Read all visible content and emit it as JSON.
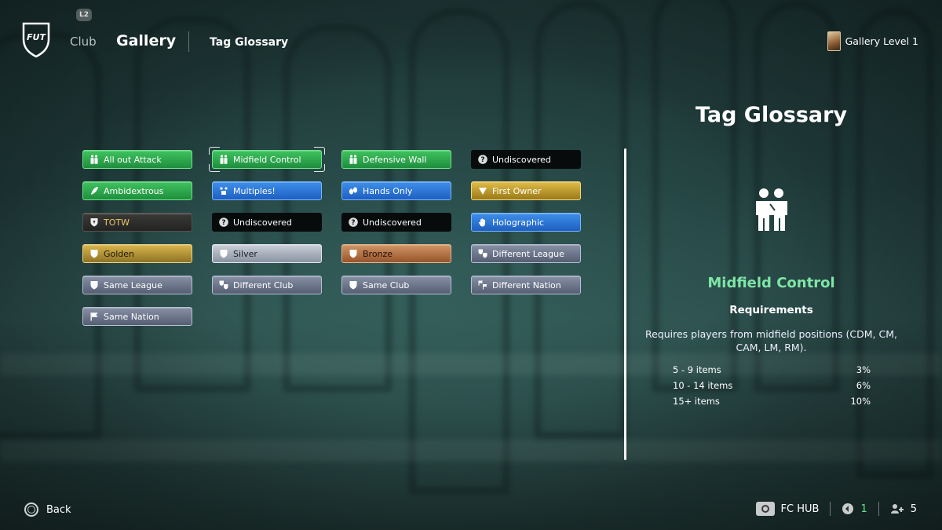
{
  "header": {
    "l2_label": "L2",
    "logo_text": "FUT",
    "nav_club": "Club",
    "nav_gallery": "Gallery",
    "nav_tag_glossary": "Tag Glossary",
    "gallery_level": "Gallery Level 1"
  },
  "tags": [
    {
      "label": "All out Attack",
      "style": "green",
      "icon": "people-icon"
    },
    {
      "label": "Midfield Control",
      "style": "green",
      "icon": "people-icon",
      "selected": true
    },
    {
      "label": "Defensive Wall",
      "style": "green",
      "icon": "people-icon"
    },
    {
      "label": "Undiscovered",
      "style": "black",
      "icon": "question-icon"
    },
    {
      "label": "Ambidextrous",
      "style": "green",
      "icon": "feather-icon"
    },
    {
      "label": "Multiples!",
      "style": "blue",
      "icon": "multiples-icon"
    },
    {
      "label": "Hands Only",
      "style": "blue",
      "icon": "hands-icon"
    },
    {
      "label": "First Owner",
      "style": "gold",
      "icon": "chevron-badge-icon"
    },
    {
      "label": "TOTW",
      "style": "totw",
      "icon": "totw-shield-icon"
    },
    {
      "label": "Undiscovered",
      "style": "black",
      "icon": "question-icon"
    },
    {
      "label": "Undiscovered",
      "style": "black",
      "icon": "question-icon"
    },
    {
      "label": "Holographic",
      "style": "blue",
      "icon": "hand-icon"
    },
    {
      "label": "Golden",
      "style": "gold2",
      "icon": "shield-icon"
    },
    {
      "label": "Silver",
      "style": "silver",
      "icon": "shield-icon"
    },
    {
      "label": "Bronze",
      "style": "bronze",
      "icon": "shield-icon"
    },
    {
      "label": "Different League",
      "style": "steel",
      "icon": "shield-pair-icon"
    },
    {
      "label": "Same League",
      "style": "steel",
      "icon": "shield-icon"
    },
    {
      "label": "Different Club",
      "style": "steel",
      "icon": "shield-pair-icon"
    },
    {
      "label": "Same Club",
      "style": "steel",
      "icon": "shield-icon"
    },
    {
      "label": "Different Nation",
      "style": "steel",
      "icon": "flag-pair-icon"
    },
    {
      "label": "Same Nation",
      "style": "steel",
      "icon": "flag-icon"
    }
  ],
  "panel": {
    "title": "Tag Glossary",
    "selected_name": "Midfield Control",
    "requirements_heading": "Requirements",
    "description": "Requires players from midfield positions (CDM, CM, CAM, LM, RM).",
    "rows": [
      {
        "items": "5 - 9 items",
        "value": "3%"
      },
      {
        "items": "10 - 14 items",
        "value": "6%"
      },
      {
        "items": "15+ items",
        "value": "10%"
      }
    ]
  },
  "footer": {
    "back_label": "Back",
    "fc_hub_label": "FC HUB",
    "count_a": "1",
    "count_b": "5"
  },
  "colors": {
    "selected_name": "#7fe6a6",
    "green_tag": "#2fa84c",
    "blue_tag": "#2f76d8",
    "gold_tag": "#c7a232"
  }
}
